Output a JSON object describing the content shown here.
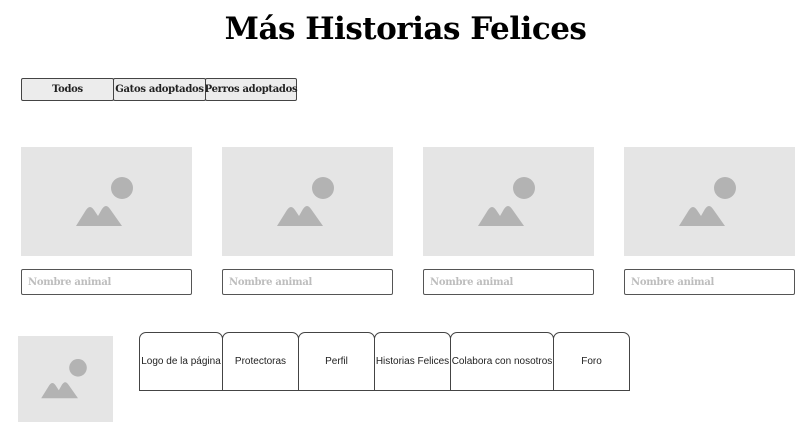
{
  "header": {
    "title": "Más Historias Felices"
  },
  "filters": [
    {
      "label": "Todos"
    },
    {
      "label": "Gatos adoptados"
    },
    {
      "label": "Perros adoptados"
    }
  ],
  "cards": [
    {
      "image_icon": "image-placeholder-icon",
      "name_placeholder": "Nombre animal"
    },
    {
      "image_icon": "image-placeholder-icon",
      "name_placeholder": "Nombre animal"
    },
    {
      "image_icon": "image-placeholder-icon",
      "name_placeholder": "Nombre animal"
    },
    {
      "image_icon": "image-placeholder-icon",
      "name_placeholder": "Nombre animal"
    }
  ],
  "footer": {
    "logo_icon": "image-placeholder-icon",
    "nav": [
      {
        "label": "Logo de la página"
      },
      {
        "label": "Protectoras"
      },
      {
        "label": "Perfil"
      },
      {
        "label": "Historias Felices"
      },
      {
        "label": "Colabora con nosotros"
      },
      {
        "label": "Foro"
      }
    ]
  },
  "colors": {
    "placeholder_bg": "#e5e5e5",
    "placeholder_icon": "#b3b3b3",
    "filter_bg": "#ececec",
    "border": "#444444"
  }
}
